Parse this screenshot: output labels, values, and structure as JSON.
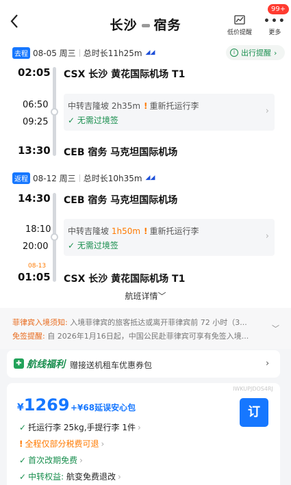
{
  "header": {
    "back_icon": "chevron-left-icon",
    "from_city": "长沙",
    "to_city": "宿务",
    "price_alert_label": "低价提醒",
    "more_label": "更多",
    "badge": "99+"
  },
  "outbound": {
    "tag": "去程",
    "date": "08-05 周三",
    "duration": "总时长11h25m",
    "remind_label": "出行提醒",
    "depart_time": "02:05",
    "depart_airport": "CSX  长沙 黄花国际机场 T1",
    "transfer_arrive": "06:50",
    "transfer_depart": "09:25",
    "transfer_text": "中转吉隆坡 2h35m",
    "recheck_text": "重新托运行李",
    "visa_text": "无需过境签",
    "arrive_time": "13:30",
    "arrive_airport": "CEB  宿务 马克坦国际机场"
  },
  "return": {
    "tag": "返程",
    "date": "08-12 周三",
    "duration": "总时长10h35m",
    "depart_time": "14:30",
    "depart_airport": "CEB  宿务 马克坦国际机场",
    "transfer_arrive": "18:10",
    "transfer_depart": "20:00",
    "transfer_city": "中转吉隆坡",
    "transfer_duration": "1h50m",
    "recheck_text": "重新托运行李",
    "visa_text": "无需过境签",
    "next_day_date": "08-13",
    "arrive_time": "01:05",
    "arrive_airport": "CSX  长沙 黄花国际机场 T1"
  },
  "detail_link": "航班详情",
  "notices": [
    {
      "key": "菲律宾入境须知:",
      "text": "入境菲律宾的旅客抵达或离开菲律宾前 72 小时（3..."
    },
    {
      "key": "免签提醒:",
      "text": "自 2026年1月16日起，中国公民赴菲律宾可享有免签入境..."
    }
  ],
  "promo": {
    "name": "航线福利",
    "desc": "赠接送机租车优惠券包"
  },
  "fare": {
    "code": "IWKUPJDOS4RJ",
    "currency": "¥",
    "price": "1269",
    "addon": "+¥68延误安心包",
    "book_label": "订",
    "items": [
      {
        "mark": "✓",
        "text": "托运行李 25kg,手提行李 1件",
        "tone": "normal"
      },
      {
        "mark": "!",
        "text": "全程仅部分税费可退",
        "tone": "warn"
      },
      {
        "mark": "✓",
        "text": "首次改期免费",
        "tone": "good"
      },
      {
        "mark": "✓",
        "prefix": "中转权益:",
        "text": "航变免费退改",
        "tone": "normal"
      }
    ]
  },
  "colors": {
    "accent": "#1677ff",
    "green": "#1a8f4f",
    "orange": "#ff7a00"
  }
}
